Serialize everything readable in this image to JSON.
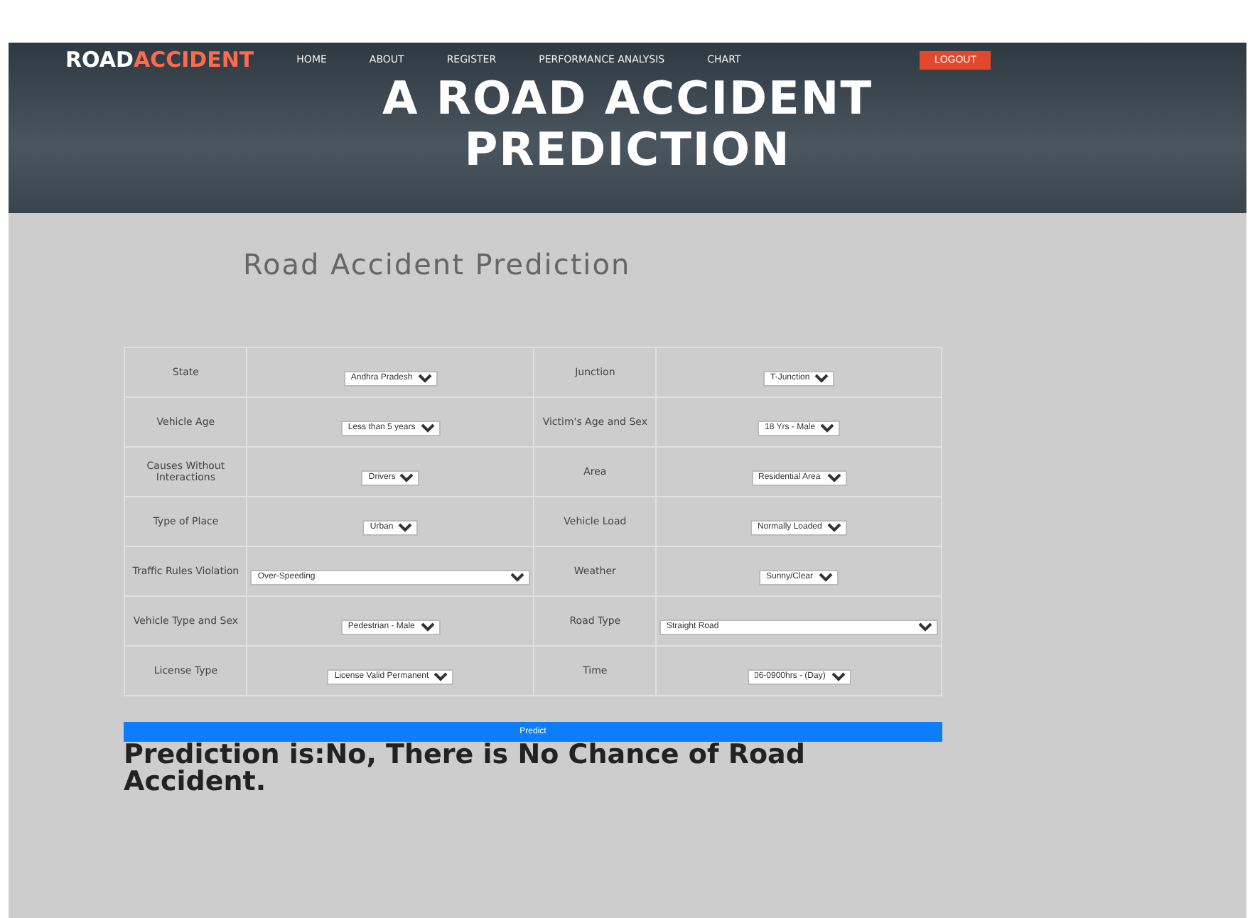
{
  "nav": {
    "brand_first": "ROAD",
    "brand_second": "ACCIDENT",
    "links": [
      "HOME",
      "ABOUT",
      "REGISTER",
      "PERFORMANCE ANALYSIS",
      "CHART"
    ],
    "action": "LOGOUT"
  },
  "hero": {
    "title": "A ROAD ACCIDENT PREDICTION"
  },
  "form": {
    "heading": "Road Accident Prediction",
    "rows": [
      [
        {
          "label": "State",
          "value": "Andhra Pradesh",
          "kind": "compact"
        },
        {
          "label": "Junction",
          "value": "T-Junction",
          "kind": "compact"
        }
      ],
      [
        {
          "label": "Vehicle Age",
          "value": "Less than 5 years",
          "kind": "compact"
        },
        {
          "label": "Victim's Age and Sex",
          "value": "18 Yrs - Male",
          "kind": "compact"
        }
      ],
      [
        {
          "label": "Causes Without Interactions",
          "value": "Drivers",
          "kind": "compact"
        },
        {
          "label": "Area",
          "value": "Residential Area",
          "kind": "compact"
        }
      ],
      [
        {
          "label": "Type of Place",
          "value": "Urban",
          "kind": "compact"
        },
        {
          "label": "Vehicle Load",
          "value": "Normally Loaded",
          "kind": "compact"
        }
      ],
      [
        {
          "label": "Traffic Rules Violation",
          "value": "Over-Speeding",
          "kind": "full"
        },
        {
          "label": "Weather",
          "value": "Sunny/Clear",
          "kind": "compact"
        }
      ],
      [
        {
          "label": "Vehicle Type and Sex",
          "value": "Pedestrian - Male",
          "kind": "compact"
        },
        {
          "label": "Road Type",
          "value": "Straight Road",
          "kind": "full"
        }
      ],
      [
        {
          "label": "License Type",
          "value": "License Valid Permanent",
          "kind": "compact"
        },
        {
          "label": "Time",
          "value": "06-0900hrs - (Day)",
          "kind": "compact"
        }
      ]
    ],
    "submit": "Predict",
    "result": "Prediction is:No, There is No Chance of Road Accident."
  }
}
